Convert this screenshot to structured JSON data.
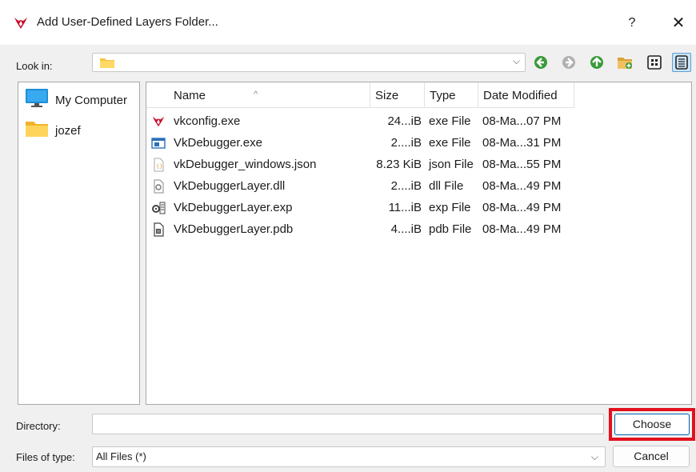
{
  "window": {
    "title": "Add User-Defined Layers Folder...",
    "help": "?",
    "close": "✕"
  },
  "lookin": {
    "label": "Look in:",
    "value": "",
    "chevron": "⌵"
  },
  "sidebar": {
    "items": [
      {
        "label": "My Computer",
        "icon": "computer-icon"
      },
      {
        "label": "jozef",
        "icon": "folder-icon"
      }
    ]
  },
  "table": {
    "sort_caret": "^",
    "columns": [
      "Name",
      "Size",
      "Type",
      "Date Modified"
    ],
    "rows": [
      {
        "name": "vkconfig.exe",
        "size": "24...iB",
        "type": "exe File",
        "date": "08-Ma...07 PM",
        "icon": "vkconfig-icon"
      },
      {
        "name": "VkDebugger.exe",
        "size": "2....iB",
        "type": "exe File",
        "date": "08-Ma...31 PM",
        "icon": "app-window-icon"
      },
      {
        "name": "vkDebugger_windows.json",
        "size": "8.23 KiB",
        "type": "json File",
        "date": "08-Ma...55 PM",
        "icon": "json-file-icon"
      },
      {
        "name": "VkDebuggerLayer.dll",
        "size": "2....iB",
        "type": "dll File",
        "date": "08-Ma...49 PM",
        "icon": "dll-file-icon"
      },
      {
        "name": "VkDebuggerLayer.exp",
        "size": "11...iB",
        "type": "exp File",
        "date": "08-Ma...49 PM",
        "icon": "exp-file-icon"
      },
      {
        "name": "VkDebuggerLayer.pdb",
        "size": "4....iB",
        "type": "pdb File",
        "date": "08-Ma...49 PM",
        "icon": "pdb-file-icon"
      }
    ]
  },
  "directory": {
    "label": "Directory:",
    "value": ""
  },
  "filetype": {
    "label": "Files of type:",
    "value": "All Files (*)",
    "chevron": "⌵"
  },
  "buttons": {
    "choose": "Choose",
    "cancel": "Cancel"
  },
  "colors": {
    "highlight": "#e3101e",
    "accent": "#0063b1",
    "nav_green": "#3a9a3a"
  }
}
